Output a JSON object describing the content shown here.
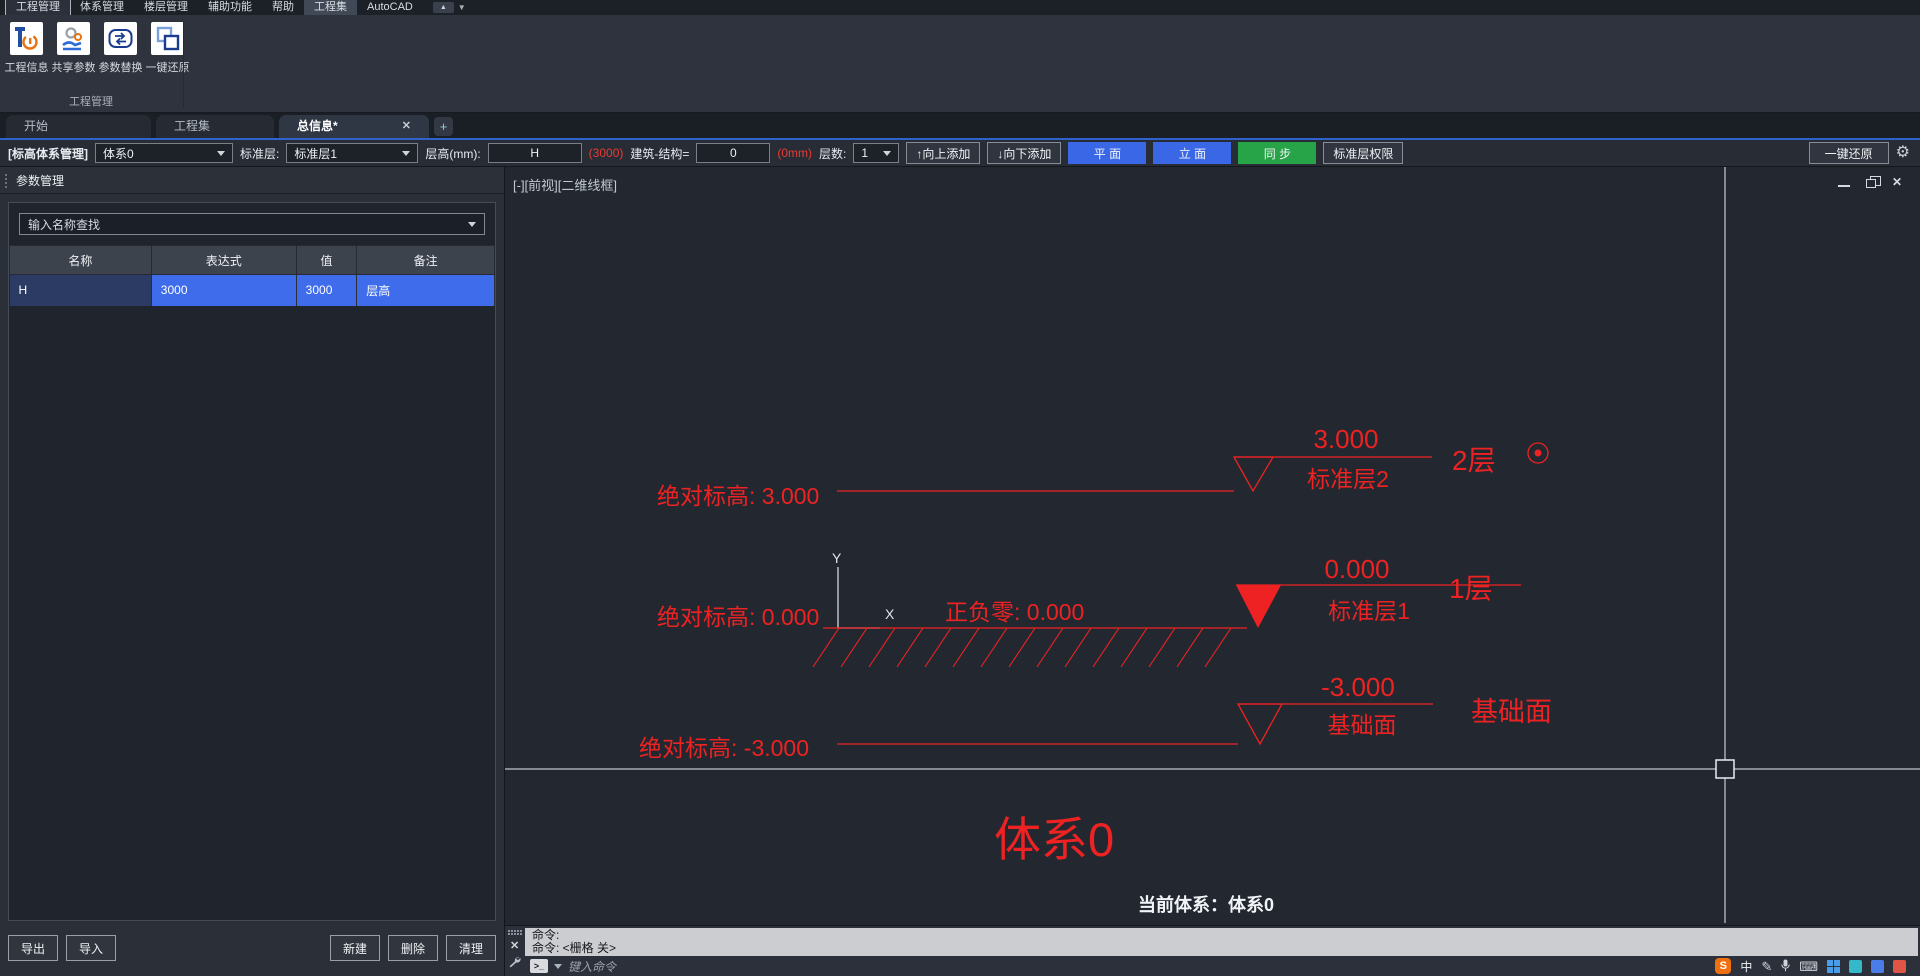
{
  "menu": {
    "items": [
      "工程管理",
      "体系管理",
      "楼层管理",
      "辅助功能",
      "帮助",
      "工程集",
      "AutoCAD"
    ]
  },
  "ribbon": {
    "buttons": [
      {
        "label": "工程信息"
      },
      {
        "label": "共享参数"
      },
      {
        "label": "参数替换"
      },
      {
        "label": "一键还原"
      }
    ],
    "group_label": "工程管理"
  },
  "tabs": {
    "items": [
      "开始",
      "工程集",
      "总信息*"
    ],
    "active": "总信息*"
  },
  "toolbar": {
    "system_label": "[标高体系管理]",
    "system_value": "体系0",
    "std_floor_label": "标准层:",
    "std_floor_value": "标准层1",
    "floor_height_label": "层高(mm):",
    "floor_height_value": "H",
    "floor_height_hint": "(3000)",
    "arch_struct_label": "建筑-结构=",
    "arch_struct_value": "0",
    "arch_struct_hint": "(0mm)",
    "floor_count_label": "层数:",
    "floor_count_value": "1",
    "add_up": "↑向上添加",
    "add_down": "↓向下添加",
    "plan_btn": "平 面",
    "elevation_btn": "立 面",
    "sync_btn": "同 步",
    "perm_btn": "标准层权限",
    "restore_btn": "一键还原"
  },
  "params_panel": {
    "title": "参数管理",
    "search_placeholder": "输入名称查找",
    "table": {
      "headers": [
        "名称",
        "表达式",
        "值",
        "备注"
      ],
      "rows": [
        [
          "H",
          "3000",
          "3000",
          "层高"
        ]
      ]
    },
    "buttons": {
      "export": "导出",
      "import": "导入",
      "new": "新建",
      "delete": "删除",
      "clean": "清理"
    }
  },
  "drawing": {
    "viewport_label": "[-][前视][二维线框]",
    "abs_level_2": "绝对标高: 3.000",
    "abs_level_1": "绝对标高: 0.000",
    "abs_level_0": "绝对标高: -3.000",
    "zero_text": "正负零: 0.000",
    "level2": {
      "elev": "3.000",
      "name": "标准层2",
      "floor": "2层"
    },
    "level1": {
      "elev": "0.000",
      "name": "标准层1",
      "floor": "1层"
    },
    "level0": {
      "elev": "-3.000",
      "name": "基础面",
      "floor": "基础面"
    },
    "system_text": "体系0",
    "current_system": "当前体系：体系0",
    "ucs_x": "X",
    "ucs_y": "Y"
  },
  "command": {
    "history_line_1": "命令:",
    "history_line_2": "命令:  <栅格 关>",
    "input_placeholder": "键入命令",
    "prompt_icon": ">_"
  },
  "icons": {
    "close": "✕",
    "plus": "+",
    "collapse": "▲",
    "caret": "▼",
    "gear": "⚙",
    "zh_indicator": "中",
    "pen": "✎",
    "keyboard": "⌨"
  },
  "colors": {
    "cad_red": "#ee2222",
    "accent_blue": "#3a67e6",
    "accent_green": "#27a348",
    "selection_blue": "#3f6ceb"
  }
}
